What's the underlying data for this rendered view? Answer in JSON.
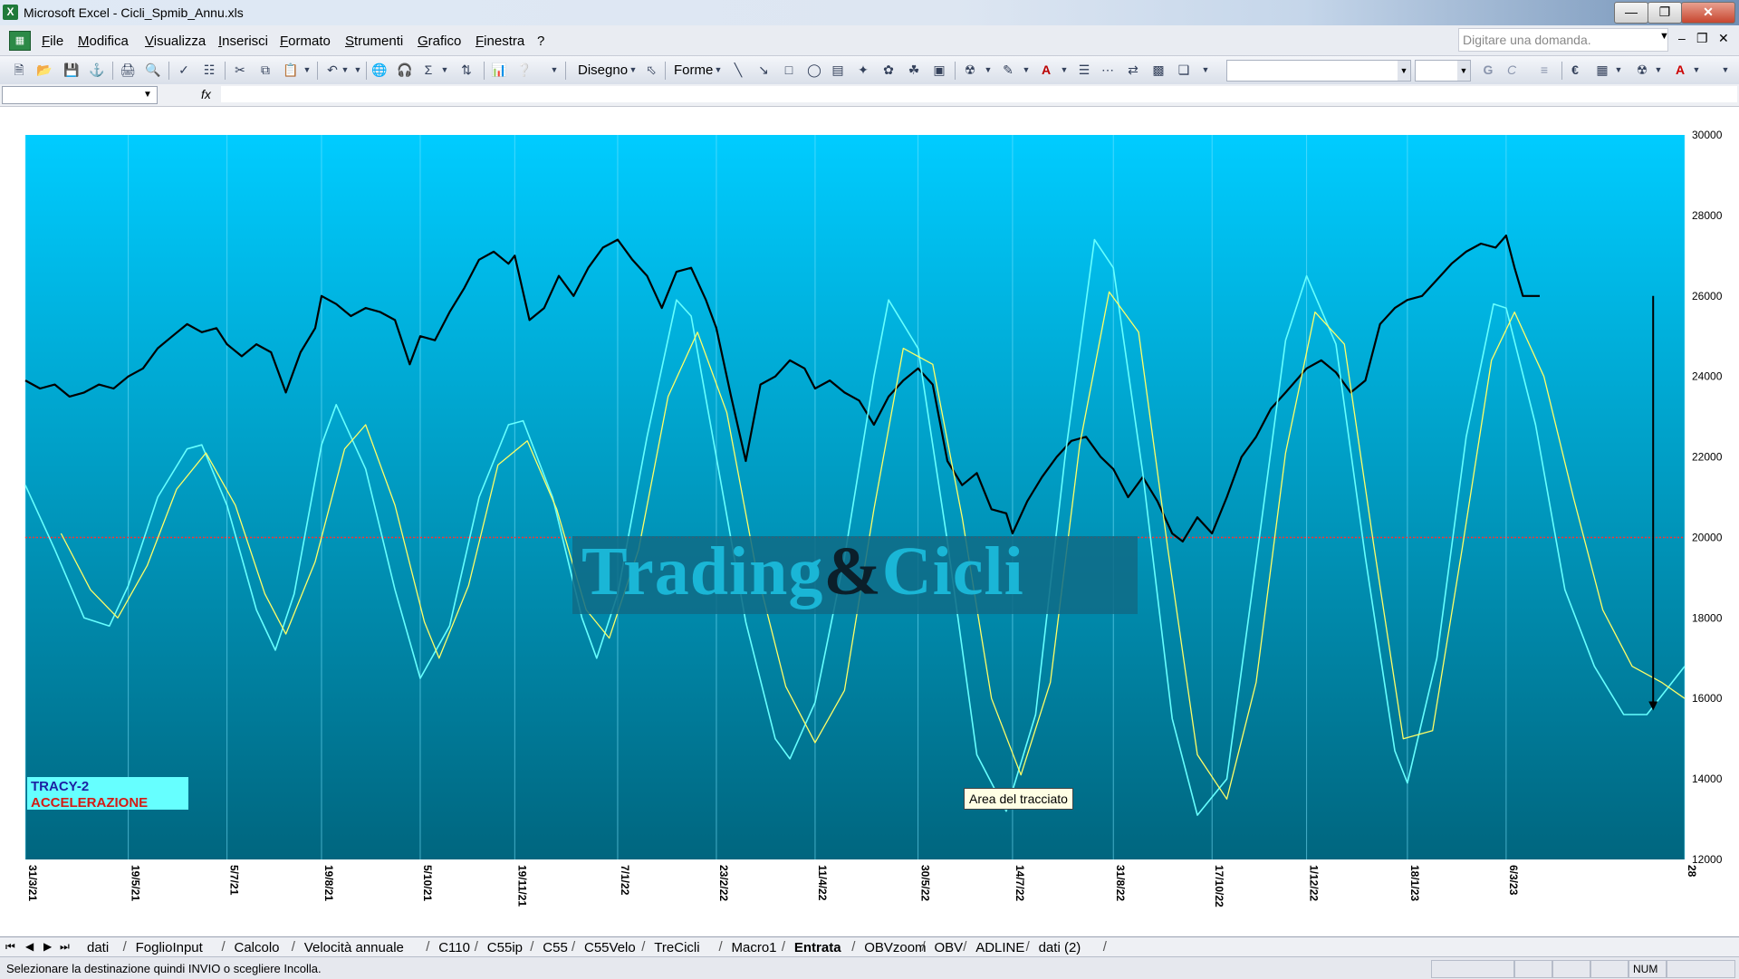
{
  "window": {
    "app_icon_text": "X",
    "title": "Microsoft Excel - Cicli_Spmib_Annu.xls"
  },
  "menu": {
    "items": [
      "File",
      "Modifica",
      "Visualizza",
      "Inserisci",
      "Formato",
      "Strumenti",
      "Grafico",
      "Finestra",
      "?"
    ],
    "help_placeholder": "Digitare una domanda."
  },
  "toolbar": {
    "draw_label": "Disegno",
    "shapes_label": "Forme",
    "font_bold": "G",
    "font_italic": "C",
    "euro": "€"
  },
  "formula_bar": {
    "fx": "fx"
  },
  "tabs": {
    "items": [
      "dati",
      "FoglioInput",
      "Calcolo",
      "Velocità annuale",
      "C110",
      "C55ip",
      "C55",
      "C55Velo",
      "TreCicli",
      "Macro1",
      "Entrata",
      "OBVzoom",
      "OBV",
      "ADLINE",
      "dati (2)"
    ],
    "active": "Entrata"
  },
  "status": {
    "text": "Selezionare la destinazione quindi INVIO o scegliere Incolla.",
    "num": "NUM"
  },
  "legend": {
    "line1": "TRACY-2",
    "line2": "ACCELERAZIONE"
  },
  "tooltip": {
    "text": "Area del tracciato"
  },
  "watermark": {
    "part1": "Trading",
    "amp": "&",
    "part2": "Cicli"
  },
  "colors": {
    "price": "#000000",
    "cyan": "#66ffff",
    "yellow": "#ffff66",
    "zero_line": "#ff3333",
    "bg_top": "#00ccff",
    "bg_bottom": "#00667f"
  },
  "chart_data": {
    "type": "line",
    "ylim": [
      12000,
      30000
    ],
    "yticks": [
      "30000",
      "28000",
      "26000",
      "24000",
      "22000",
      "20000",
      "18000",
      "16000",
      "14000",
      "12000"
    ],
    "xlim": [
      "2021-03-31",
      "2023-05-30"
    ],
    "xticks": [
      {
        "label": "31/3/21",
        "date": "2021-03-31"
      },
      {
        "label": "19/5/21",
        "date": "2021-05-19"
      },
      {
        "label": "5/7/21",
        "date": "2021-07-05"
      },
      {
        "label": "19/8/21",
        "date": "2021-08-19"
      },
      {
        "label": "5/10/21",
        "date": "2021-10-05"
      },
      {
        "label": "19/11/21",
        "date": "2021-11-19"
      },
      {
        "label": "7/1/22",
        "date": "2022-01-07"
      },
      {
        "label": "23/2/22",
        "date": "2022-02-23"
      },
      {
        "label": "11/4/22",
        "date": "2022-04-11"
      },
      {
        "label": "30/5/22",
        "date": "2022-05-30"
      },
      {
        "label": "14/7/22",
        "date": "2022-07-14"
      },
      {
        "label": "31/8/22",
        "date": "2022-08-31"
      },
      {
        "label": "17/10/22",
        "date": "2022-10-17"
      },
      {
        "label": "1/12/22",
        "date": "2022-12-01"
      },
      {
        "label": "18/1/23",
        "date": "2023-01-18"
      },
      {
        "label": "6/3/23",
        "date": "2023-03-06"
      },
      {
        "label": "28",
        "date": "2023-05-30"
      }
    ],
    "reference_line": 20000,
    "arrow": {
      "date": "2023-05-15",
      "from": 26000,
      "to": 15700
    },
    "series": [
      {
        "key": "price",
        "points": [
          [
            "2021-03-31",
            23900
          ],
          [
            "2021-04-07",
            23700
          ],
          [
            "2021-04-14",
            23800
          ],
          [
            "2021-04-21",
            23500
          ],
          [
            "2021-04-28",
            23600
          ],
          [
            "2021-05-05",
            23800
          ],
          [
            "2021-05-12",
            23700
          ],
          [
            "2021-05-19",
            24000
          ],
          [
            "2021-05-26",
            24200
          ],
          [
            "2021-06-02",
            24700
          ],
          [
            "2021-06-09",
            25000
          ],
          [
            "2021-06-16",
            25300
          ],
          [
            "2021-06-23",
            25100
          ],
          [
            "2021-06-30",
            25200
          ],
          [
            "2021-07-05",
            24800
          ],
          [
            "2021-07-12",
            24500
          ],
          [
            "2021-07-19",
            24800
          ],
          [
            "2021-07-26",
            24600
          ],
          [
            "2021-08-02",
            23600
          ],
          [
            "2021-08-09",
            24600
          ],
          [
            "2021-08-16",
            25200
          ],
          [
            "2021-08-19",
            26000
          ],
          [
            "2021-08-26",
            25800
          ],
          [
            "2021-09-02",
            25500
          ],
          [
            "2021-09-09",
            25700
          ],
          [
            "2021-09-16",
            25600
          ],
          [
            "2021-09-23",
            25400
          ],
          [
            "2021-09-30",
            24300
          ],
          [
            "2021-10-05",
            25000
          ],
          [
            "2021-10-12",
            24900
          ],
          [
            "2021-10-19",
            25600
          ],
          [
            "2021-10-26",
            26200
          ],
          [
            "2021-11-02",
            26900
          ],
          [
            "2021-11-09",
            27100
          ],
          [
            "2021-11-16",
            26800
          ],
          [
            "2021-11-19",
            27000
          ],
          [
            "2021-11-26",
            25400
          ],
          [
            "2021-12-03",
            25700
          ],
          [
            "2021-12-10",
            26500
          ],
          [
            "2021-12-17",
            26000
          ],
          [
            "2021-12-24",
            26700
          ],
          [
            "2021-12-31",
            27200
          ],
          [
            "2022-01-07",
            27400
          ],
          [
            "2022-01-14",
            26900
          ],
          [
            "2022-01-21",
            26500
          ],
          [
            "2022-01-28",
            25700
          ],
          [
            "2022-02-04",
            26600
          ],
          [
            "2022-02-11",
            26700
          ],
          [
            "2022-02-18",
            25900
          ],
          [
            "2022-02-23",
            25200
          ],
          [
            "2022-03-02",
            23500
          ],
          [
            "2022-03-09",
            21900
          ],
          [
            "2022-03-16",
            23800
          ],
          [
            "2022-03-23",
            24000
          ],
          [
            "2022-03-30",
            24400
          ],
          [
            "2022-04-06",
            24200
          ],
          [
            "2022-04-11",
            23700
          ],
          [
            "2022-04-18",
            23900
          ],
          [
            "2022-04-25",
            23600
          ],
          [
            "2022-05-02",
            23400
          ],
          [
            "2022-05-09",
            22800
          ],
          [
            "2022-05-16",
            23500
          ],
          [
            "2022-05-23",
            23900
          ],
          [
            "2022-05-30",
            24200
          ],
          [
            "2022-06-06",
            23800
          ],
          [
            "2022-06-13",
            21900
          ],
          [
            "2022-06-20",
            21300
          ],
          [
            "2022-06-27",
            21600
          ],
          [
            "2022-07-04",
            20700
          ],
          [
            "2022-07-11",
            20600
          ],
          [
            "2022-07-14",
            20100
          ],
          [
            "2022-07-21",
            20900
          ],
          [
            "2022-07-28",
            21500
          ],
          [
            "2022-08-04",
            22000
          ],
          [
            "2022-08-11",
            22400
          ],
          [
            "2022-08-18",
            22500
          ],
          [
            "2022-08-25",
            22000
          ],
          [
            "2022-08-31",
            21700
          ],
          [
            "2022-09-07",
            21000
          ],
          [
            "2022-09-14",
            21500
          ],
          [
            "2022-09-21",
            20900
          ],
          [
            "2022-09-28",
            20100
          ],
          [
            "2022-10-03",
            19900
          ],
          [
            "2022-10-10",
            20500
          ],
          [
            "2022-10-17",
            20100
          ],
          [
            "2022-10-24",
            21000
          ],
          [
            "2022-10-31",
            22000
          ],
          [
            "2022-11-07",
            22500
          ],
          [
            "2022-11-14",
            23200
          ],
          [
            "2022-11-21",
            23600
          ],
          [
            "2022-12-01",
            24200
          ],
          [
            "2022-12-08",
            24400
          ],
          [
            "2022-12-15",
            24100
          ],
          [
            "2022-12-22",
            23600
          ],
          [
            "2022-12-29",
            23900
          ],
          [
            "2023-01-05",
            25300
          ],
          [
            "2023-01-12",
            25700
          ],
          [
            "2023-01-18",
            25900
          ],
          [
            "2023-01-25",
            26000
          ],
          [
            "2023-02-01",
            26400
          ],
          [
            "2023-02-08",
            26800
          ],
          [
            "2023-02-15",
            27100
          ],
          [
            "2023-02-22",
            27300
          ],
          [
            "2023-03-01",
            27200
          ],
          [
            "2023-03-06",
            27500
          ],
          [
            "2023-03-10",
            26700
          ],
          [
            "2023-03-14",
            26000
          ],
          [
            "2023-03-22",
            26000
          ]
        ]
      },
      {
        "key": "cyan",
        "points": [
          [
            "2021-03-31",
            21300
          ],
          [
            "2021-04-14",
            19700
          ],
          [
            "2021-04-28",
            18000
          ],
          [
            "2021-05-10",
            17800
          ],
          [
            "2021-05-19",
            18800
          ],
          [
            "2021-06-02",
            21000
          ],
          [
            "2021-06-16",
            22200
          ],
          [
            "2021-06-23",
            22300
          ],
          [
            "2021-07-05",
            20800
          ],
          [
            "2021-07-19",
            18200
          ],
          [
            "2021-07-28",
            17200
          ],
          [
            "2021-08-06",
            18600
          ],
          [
            "2021-08-19",
            22300
          ],
          [
            "2021-08-26",
            23300
          ],
          [
            "2021-09-09",
            21700
          ],
          [
            "2021-09-23",
            18700
          ],
          [
            "2021-10-05",
            16500
          ],
          [
            "2021-10-19",
            17800
          ],
          [
            "2021-11-02",
            21000
          ],
          [
            "2021-11-16",
            22800
          ],
          [
            "2021-11-23",
            22900
          ],
          [
            "2021-12-07",
            21000
          ],
          [
            "2021-12-21",
            18000
          ],
          [
            "2021-12-28",
            17000
          ],
          [
            "2022-01-07",
            18600
          ],
          [
            "2022-01-21",
            22500
          ],
          [
            "2022-02-04",
            25900
          ],
          [
            "2022-02-11",
            25500
          ],
          [
            "2022-02-23",
            22000
          ],
          [
            "2022-03-09",
            17900
          ],
          [
            "2022-03-23",
            15000
          ],
          [
            "2022-03-30",
            14500
          ],
          [
            "2022-04-11",
            15900
          ],
          [
            "2022-04-25",
            19500
          ],
          [
            "2022-05-09",
            24000
          ],
          [
            "2022-05-16",
            25900
          ],
          [
            "2022-05-30",
            24700
          ],
          [
            "2022-06-13",
            19900
          ],
          [
            "2022-06-27",
            14600
          ],
          [
            "2022-07-11",
            13200
          ],
          [
            "2022-07-25",
            15600
          ],
          [
            "2022-08-08",
            22000
          ],
          [
            "2022-08-22",
            27400
          ],
          [
            "2022-08-31",
            26700
          ],
          [
            "2022-09-14",
            21600
          ],
          [
            "2022-09-28",
            15500
          ],
          [
            "2022-10-10",
            13100
          ],
          [
            "2022-10-24",
            14000
          ],
          [
            "2022-11-07",
            19400
          ],
          [
            "2022-11-21",
            24900
          ],
          [
            "2022-12-01",
            26500
          ],
          [
            "2022-12-15",
            24800
          ],
          [
            "2022-12-29",
            19500
          ],
          [
            "2023-01-12",
            14700
          ],
          [
            "2023-01-18",
            13900
          ],
          [
            "2023-02-01",
            17000
          ],
          [
            "2023-02-15",
            22500
          ],
          [
            "2023-02-28",
            25800
          ],
          [
            "2023-03-06",
            25700
          ],
          [
            "2023-03-20",
            22800
          ],
          [
            "2023-04-03",
            18700
          ],
          [
            "2023-04-17",
            16800
          ],
          [
            "2023-05-01",
            15600
          ],
          [
            "2023-05-12",
            15600
          ],
          [
            "2023-05-30",
            16800
          ]
        ]
      },
      {
        "key": "yellow",
        "points": [
          [
            "2021-04-17",
            20100
          ],
          [
            "2021-05-01",
            18700
          ],
          [
            "2021-05-14",
            18000
          ],
          [
            "2021-05-28",
            19300
          ],
          [
            "2021-06-11",
            21200
          ],
          [
            "2021-06-25",
            22100
          ],
          [
            "2021-07-09",
            20800
          ],
          [
            "2021-07-23",
            18600
          ],
          [
            "2021-08-02",
            17600
          ],
          [
            "2021-08-16",
            19400
          ],
          [
            "2021-08-30",
            22200
          ],
          [
            "2021-09-09",
            22800
          ],
          [
            "2021-09-23",
            20800
          ],
          [
            "2021-10-07",
            17900
          ],
          [
            "2021-10-14",
            17000
          ],
          [
            "2021-10-28",
            18800
          ],
          [
            "2021-11-11",
            21800
          ],
          [
            "2021-11-25",
            22400
          ],
          [
            "2021-12-09",
            20700
          ],
          [
            "2021-12-23",
            18200
          ],
          [
            "2022-01-03",
            17500
          ],
          [
            "2022-01-17",
            19700
          ],
          [
            "2022-01-31",
            23500
          ],
          [
            "2022-02-14",
            25100
          ],
          [
            "2022-02-28",
            23100
          ],
          [
            "2022-03-14",
            19200
          ],
          [
            "2022-03-28",
            16300
          ],
          [
            "2022-04-11",
            14900
          ],
          [
            "2022-04-25",
            16200
          ],
          [
            "2022-05-09",
            20700
          ],
          [
            "2022-05-23",
            24700
          ],
          [
            "2022-06-06",
            24300
          ],
          [
            "2022-06-20",
            20500
          ],
          [
            "2022-07-04",
            16000
          ],
          [
            "2022-07-18",
            14100
          ],
          [
            "2022-08-01",
            16400
          ],
          [
            "2022-08-15",
            22300
          ],
          [
            "2022-08-29",
            26100
          ],
          [
            "2022-09-12",
            25100
          ],
          [
            "2022-09-26",
            19700
          ],
          [
            "2022-10-10",
            14600
          ],
          [
            "2022-10-24",
            13500
          ],
          [
            "2022-11-07",
            16400
          ],
          [
            "2022-11-21",
            22100
          ],
          [
            "2022-12-05",
            25600
          ],
          [
            "2022-12-19",
            24800
          ],
          [
            "2023-01-02",
            19800
          ],
          [
            "2023-01-16",
            15000
          ],
          [
            "2023-01-30",
            15200
          ],
          [
            "2023-02-13",
            19700
          ],
          [
            "2023-02-27",
            24400
          ],
          [
            "2023-03-10",
            25600
          ],
          [
            "2023-03-24",
            24000
          ],
          [
            "2023-04-07",
            21000
          ],
          [
            "2023-04-21",
            18200
          ],
          [
            "2023-05-05",
            16800
          ],
          [
            "2023-05-19",
            16400
          ],
          [
            "2023-05-30",
            16000
          ]
        ]
      }
    ]
  }
}
